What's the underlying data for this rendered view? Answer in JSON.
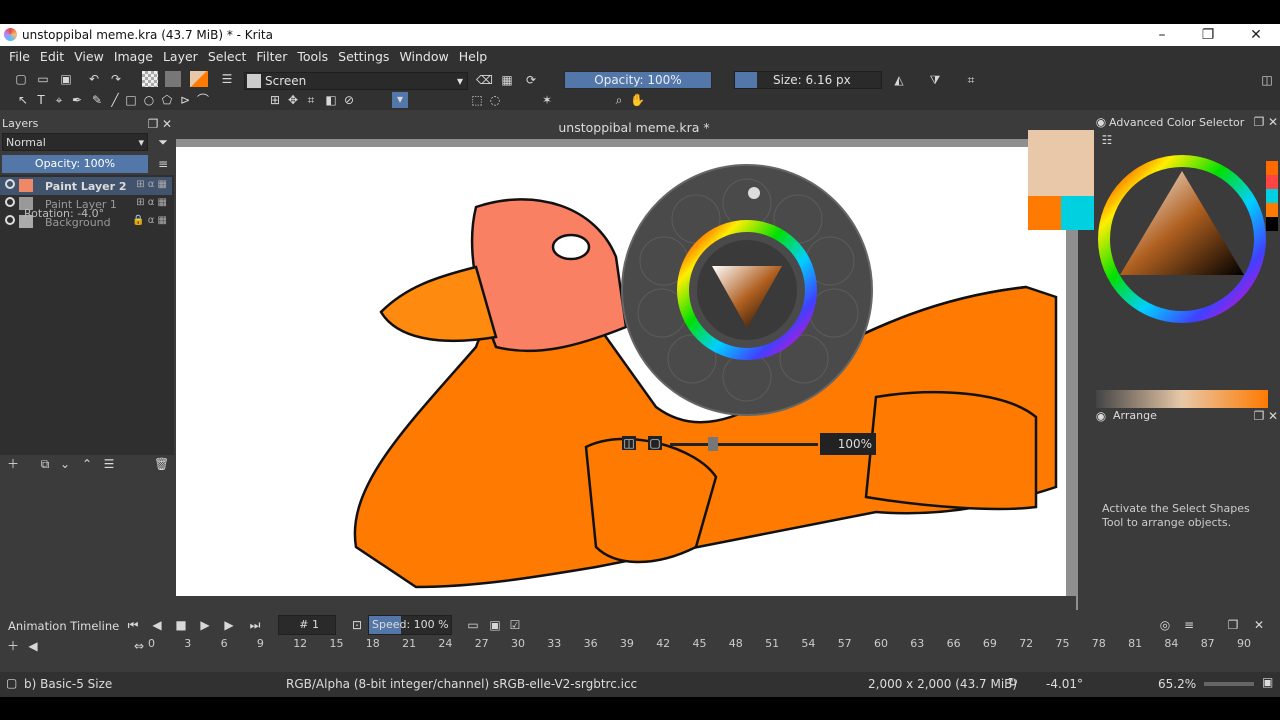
{
  "window": {
    "title": "unstoppibal meme.kra (43.7 MiB)  * - Krita",
    "minimize": "–",
    "maximize": "❐",
    "close": "✕"
  },
  "menu": [
    "File",
    "Edit",
    "View",
    "Image",
    "Layer",
    "Select",
    "Filter",
    "Tools",
    "Settings",
    "Window",
    "Help"
  ],
  "toolbar": {
    "brush_preset": "Screen",
    "opacity": "Opacity: 100%",
    "size": "Size: 6.16 px",
    "size_fraction": 0.15
  },
  "layers": {
    "title": "Layers",
    "blend_mode": "Normal",
    "opacity": "Opacity:  100%",
    "items": [
      {
        "name": "Paint Layer 2",
        "selected": true
      },
      {
        "name": "Paint Layer 1"
      },
      {
        "name": "Background"
      }
    ],
    "rotation_overlay": "Rotation: -4.0°"
  },
  "canvas": {
    "doc_title": "unstoppibal meme.kra *",
    "zoom_overlay": "100%"
  },
  "right": {
    "acs_title": "Advanced Color Selector",
    "arrange_title": "Arrange",
    "arrange_msg": "Activate the Select Shapes Tool to arrange objects."
  },
  "timeline": {
    "title": "Animation Timeline",
    "frame": "# 1",
    "speed": "Speed:  100 %",
    "ruler": [
      "0",
      "3",
      "6",
      "9",
      "12",
      "15",
      "18",
      "21",
      "24",
      "27",
      "30",
      "33",
      "36",
      "39",
      "42",
      "45",
      "48",
      "51",
      "54",
      "57",
      "60",
      "63",
      "66",
      "69",
      "72",
      "75",
      "78",
      "81",
      "84",
      "87",
      "90"
    ]
  },
  "status": {
    "brush": "b) Basic-5 Size",
    "color_space": "RGB/Alpha (8-bit integer/channel)  sRGB-elle-V2-srgbtrc.icc",
    "dimensions": "2,000 x 2,000 (43.7 MiB)",
    "rotation": "-4.01°",
    "zoom": "65.2%"
  },
  "colors": {
    "accent": "#5377a8",
    "fg": "#e8c8a8",
    "bg": "#ff7a00"
  }
}
